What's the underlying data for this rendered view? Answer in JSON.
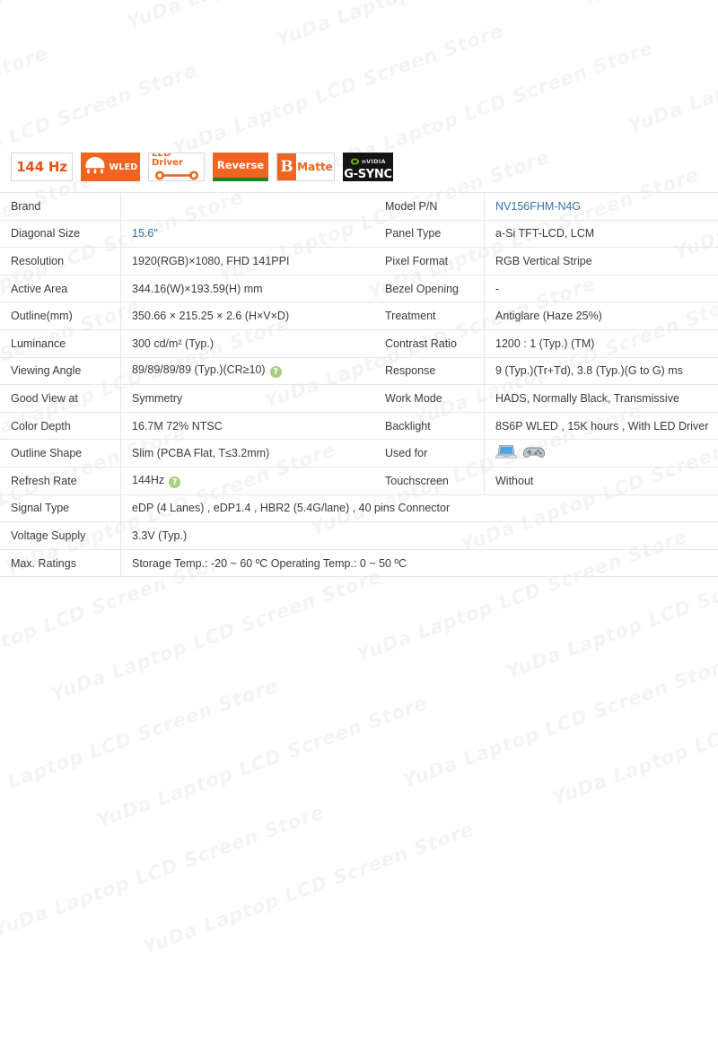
{
  "badges": [
    {
      "id": "refresh-rate-badge",
      "icon": "none",
      "text": "144 Hz"
    },
    {
      "id": "wled-badge",
      "icon": "bulb-icon",
      "text": "WLED"
    },
    {
      "id": "led-driver-badge",
      "icon": "driver-bar-icon",
      "text": "LED Driver"
    },
    {
      "id": "reverse-badge",
      "icon": "none",
      "text": "Reverse"
    },
    {
      "id": "matte-badge",
      "icon": "b-mark-icon",
      "text": "Matte",
      "mark": "B"
    },
    {
      "id": "gsync-badge",
      "icon": "nvidia-eye-icon",
      "brand": "nVIDIA",
      "text": "G-SYNC"
    }
  ],
  "table": {
    "rows": [
      {
        "label_left": "Brand",
        "value_left": "",
        "value_left_link": false,
        "label_right": "Model P/N",
        "value_right": "NV156FHM-N4G",
        "value_right_link": true
      },
      {
        "label_left": "Diagonal Size",
        "value_left": "15.6\"",
        "value_left_link": true,
        "label_right": "Panel Type",
        "value_right": "a-Si TFT-LCD, LCM",
        "value_right_link": false
      },
      {
        "label_left": "Resolution",
        "value_left": "1920(RGB)×1080, FHD  141PPI",
        "value_left_link": false,
        "label_right": "Pixel Format",
        "value_right": "RGB Vertical Stripe",
        "value_right_link": false
      },
      {
        "label_left": "Active Area",
        "value_left": "344.16(W)×193.59(H) mm",
        "value_left_link": false,
        "label_right": "Bezel Opening",
        "value_right": "-",
        "value_right_link": false
      },
      {
        "label_left": "Outline(mm)",
        "value_left": "350.66 × 215.25 × 2.6 (H×V×D)",
        "value_left_link": false,
        "label_right": "Treatment",
        "value_right": "Antiglare (Haze 25%)",
        "value_right_link": false
      },
      {
        "label_left": "Luminance",
        "value_left": "300 cd/m² (Typ.)",
        "value_left_link": false,
        "label_right": "Contrast Ratio",
        "value_right": "1200 : 1 (Typ.) (TM)",
        "value_right_link": false
      },
      {
        "label_left": "Viewing Angle",
        "value_left": "89/89/89/89 (Typ.)(CR≥10)",
        "value_left_link": false,
        "value_left_help": true,
        "label_right": "Response",
        "value_right": "9 (Typ.)(Tr+Td), 3.8 (Typ.)(G to G) ms",
        "value_right_link": false
      },
      {
        "label_left": "Good View at",
        "value_left": "Symmetry",
        "value_left_link": false,
        "label_right": "Work Mode",
        "value_right": "HADS, Normally Black, Transmissive",
        "value_right_link": false
      },
      {
        "label_left": "Color Depth",
        "value_left": "16.7M   72% NTSC",
        "value_left_link": false,
        "label_right": "Backlight",
        "value_right": "8S6P WLED , 15K hours , With LED Driver",
        "value_right_link": false
      },
      {
        "label_left": "Outline Shape",
        "value_left": "Slim (PCBA Flat, T≤3.2mm)",
        "value_left_link": false,
        "label_right": "Used for",
        "value_right": "",
        "value_right_icons": [
          "laptop-icon",
          "gamepad-icon"
        ]
      },
      {
        "label_left": "Refresh Rate",
        "value_left": "144Hz",
        "value_left_link": false,
        "value_left_help": true,
        "label_right": "Touchscreen",
        "value_right": "Without",
        "value_right_link": false
      }
    ],
    "wide_rows": [
      {
        "label": "Signal Type",
        "value": "eDP (4 Lanes) , eDP1.4 , HBR2 (5.4G/lane) , 40 pins Connector"
      },
      {
        "label": "Voltage Supply",
        "value": "3.3V (Typ.)"
      },
      {
        "label": "Max. Ratings",
        "value": "Storage Temp.: -20 ~ 60 ºC   Operating Temp.: 0 ~ 50 ºC"
      }
    ]
  },
  "watermark": {
    "text": "YuDa Laptop LCD Screen Store"
  },
  "colors": {
    "brand_orange": "#ef6420",
    "link_blue": "#3a6ea5",
    "help_green": "#a8cf7e",
    "reverse_green": "#2a7a2a",
    "gsync_black": "#141414",
    "border_gray": "#e6e6e6"
  }
}
